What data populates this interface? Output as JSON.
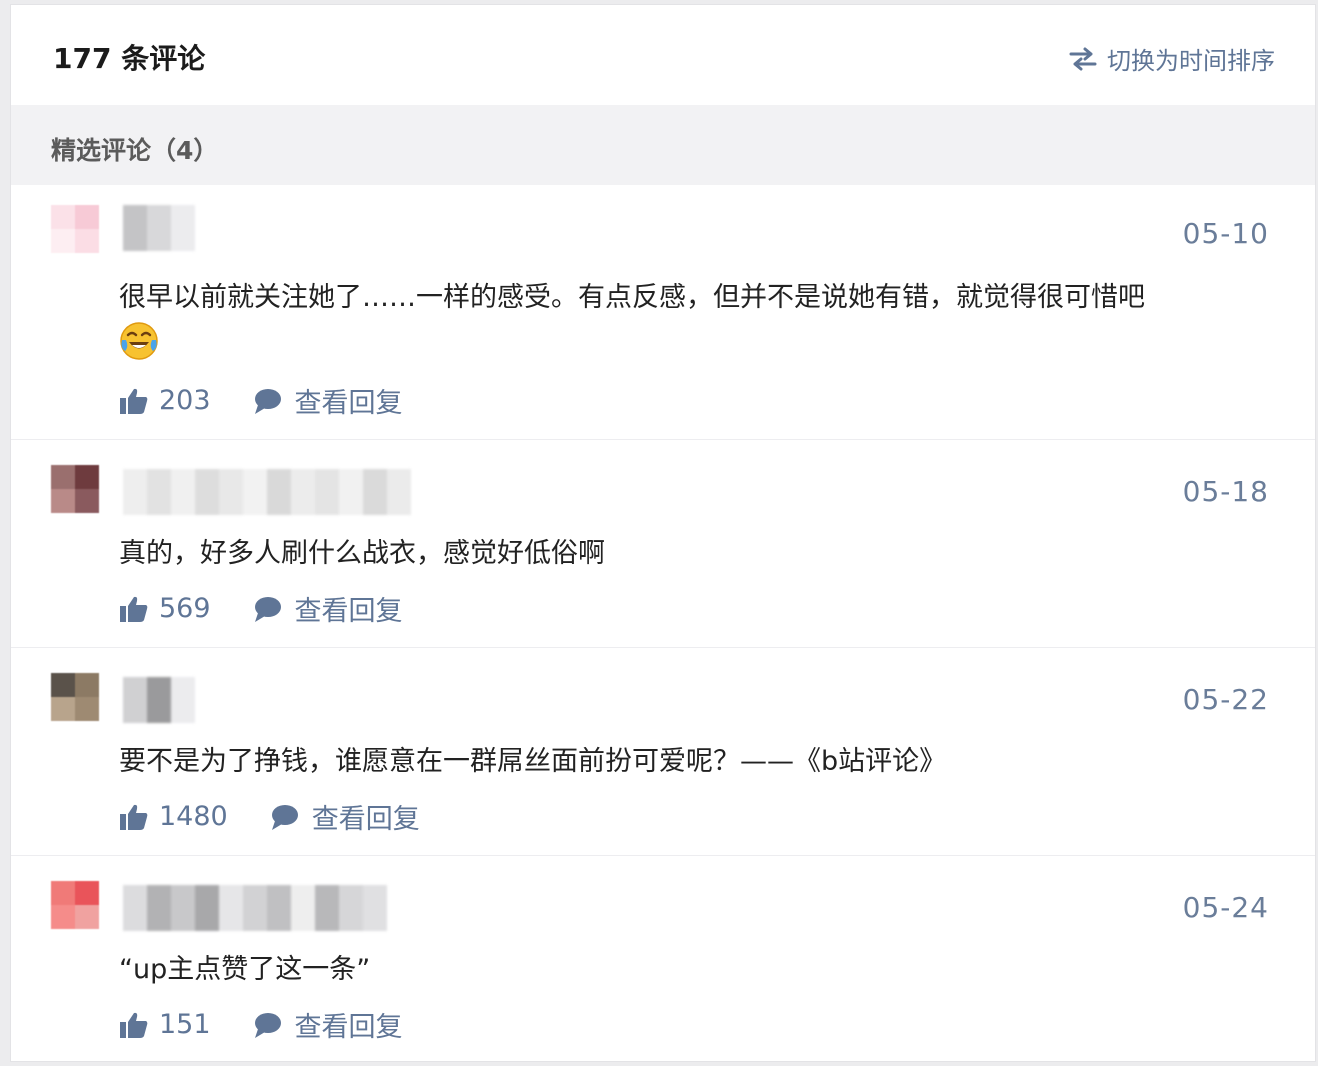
{
  "header": {
    "count_title": "177 条评论",
    "sort_toggle_label": "切换为时间排序"
  },
  "featured": {
    "label": "精选评论（4）"
  },
  "comments": [
    {
      "date": "05-10",
      "text": "很早以前就关注她了……一样的感受。有点反感，但并不是说她有错，就觉得很可惜吧",
      "emoji": "crying-laughing-emoji",
      "likes": "203",
      "reply_label": "查看回复"
    },
    {
      "date": "05-18",
      "text": "真的，好多人刷什么战衣，感觉好低俗啊",
      "likes": "569",
      "reply_label": "查看回复"
    },
    {
      "date": "05-22",
      "text": "要不是为了挣钱，谁愿意在一群屌丝面前扮可爱呢？——《b站评论》",
      "likes": "1480",
      "reply_label": "查看回复"
    },
    {
      "date": "05-24",
      "text": "“up主点赞了这一条”",
      "likes": "151",
      "reply_label": "查看回复"
    }
  ],
  "colors": {
    "accent": "#5f7596",
    "text": "#222222",
    "featured_bg": "#f2f2f4"
  }
}
